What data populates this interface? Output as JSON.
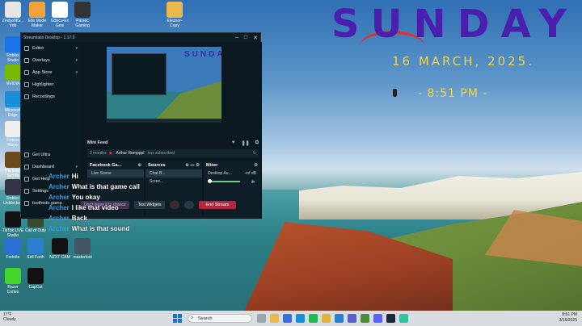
{
  "wallpaper": {
    "day": "SUNDAY",
    "date": "16 MARCH, 2025.",
    "time": "- 8:51 PM -"
  },
  "desktop_icons": [
    {
      "label": "ZeidysNG... Vdb",
      "icon": "doc-icon",
      "color": "#e6e6e6"
    },
    {
      "label": "Elle Mode Maker",
      "icon": "app-icon",
      "color": "#f0a33b"
    },
    {
      "label": "Gdocu-Ex Gesi",
      "icon": "doc-icon",
      "color": "#ffffff"
    },
    {
      "label": "Parsec Gaming",
      "icon": "parsec-icon",
      "color": "#333333"
    },
    {
      "label": "Eleanor-Copy",
      "icon": "folder-icon",
      "color": "#e8b84a"
    },
    {
      "label": "Roblox Studio",
      "icon": "roblox-icon",
      "color": "#1b73e8"
    },
    {
      "label": "NVIDIA",
      "icon": "nvidia-icon",
      "color": "#76b900"
    },
    {
      "label": "Microsoft Edge",
      "icon": "edge-icon",
      "color": "#1a8fd6"
    },
    {
      "label": "Roblox Player",
      "icon": "roblox-icon",
      "color": "#eeeeee"
    },
    {
      "label": "The Elder Scrolls Online",
      "icon": "game-icon",
      "color": "#6b4b1e"
    },
    {
      "label": "Roblox Unblocked",
      "icon": "game-icon",
      "color": "#334"
    },
    {
      "label": "TikTok LIVE Studio",
      "icon": "tiktok-icon",
      "color": "#111111"
    },
    {
      "label": "Call of Duty",
      "icon": "game-icon",
      "color": "#3a4a2a"
    },
    {
      "label": "Fortnite",
      "icon": "game-icon",
      "color": "#2b6fd6"
    },
    {
      "label": "Sell Forth",
      "icon": "app-icon",
      "color": "#2a7fd0"
    },
    {
      "label": "NZXT CAM",
      "icon": "nzxt-icon",
      "color": "#111111"
    },
    {
      "label": "mastertool",
      "icon": "app-icon",
      "color": "#445566"
    },
    {
      "label": "Razer Cortex",
      "icon": "razer-icon",
      "color": "#44d62c"
    },
    {
      "label": "CapCut",
      "icon": "capcut-icon",
      "color": "#111111"
    }
  ],
  "streamlabs": {
    "title": "Streamlabs Desktop - 1.17.0",
    "sidebar": [
      {
        "label": "Editor",
        "icon": "editor-icon",
        "chev": "▾"
      },
      {
        "label": "Overlays",
        "icon": "overlays-icon",
        "chev": "▾"
      },
      {
        "label": "App Store",
        "icon": "store-icon",
        "chev": "▾"
      },
      {
        "label": "Highlighter",
        "icon": "highlighter-icon",
        "chev": ""
      },
      {
        "label": "Recordings",
        "icon": "recordings-icon",
        "chev": ""
      }
    ],
    "sidebar_bottom": [
      {
        "label": "Get Ultra",
        "icon": "ultra-icon"
      },
      {
        "label": "Dashboard",
        "icon": "dashboard-icon",
        "chev": "▾"
      },
      {
        "label": "Get Help",
        "icon": "help-icon"
      },
      {
        "label": "Settings",
        "icon": "settings-icon"
      },
      {
        "label": "toothedo gama",
        "icon": "user-icon"
      }
    ],
    "mini_feed": {
      "title": "Mini Feed",
      "time": "2 months",
      "user": "Arthur Rompppl",
      "event": "has subscribed"
    },
    "scenes": {
      "title": "Facebook Ga...",
      "items": [
        "Live Scene"
      ]
    },
    "sources": {
      "title": "Sources",
      "items": [
        "Chat B...",
        "Scree..."
      ]
    },
    "mixer": {
      "title": "Mixer",
      "items": [
        {
          "name": "Desktop Au...",
          "level": "-inf dB"
        }
      ]
    },
    "bottom": {
      "fb_prompt": "Don't leave it to chance",
      "test_widgets": "Test Widgets",
      "end_stream": "End Stream"
    }
  },
  "chat": [
    {
      "name": "Archer",
      "msg": "Hi"
    },
    {
      "name": "Archer",
      "msg": "What is that game call"
    },
    {
      "name": "Archer",
      "msg": "You okay"
    },
    {
      "name": "Archer",
      "msg": "I like that video"
    },
    {
      "name": "Archer",
      "msg": "Back"
    },
    {
      "name": "Archer",
      "msg": "What is that sound"
    }
  ],
  "taskbar": {
    "weather_temp": "17°F",
    "weather_desc": "Cloudy",
    "search_placeholder": "Search",
    "clock_time": "8:51 PM",
    "clock_date": "3/16/2025"
  }
}
